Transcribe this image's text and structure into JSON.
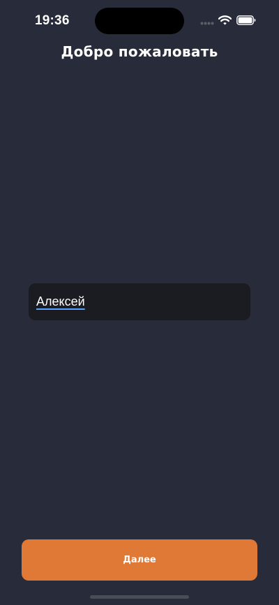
{
  "status_bar": {
    "time": "19:36",
    "icons": [
      "cellular-icon",
      "wifi-icon",
      "battery-icon"
    ]
  },
  "header": {
    "title": "Добро пожаловать"
  },
  "name_field": {
    "value": "Алексей"
  },
  "next_button": {
    "label": "Далее"
  },
  "colors": {
    "background": "#272b3a",
    "field_background": "#1b1c21",
    "accent": "#e07836",
    "text": "#ffffff",
    "cursor_underline": "#5aa4ff"
  }
}
